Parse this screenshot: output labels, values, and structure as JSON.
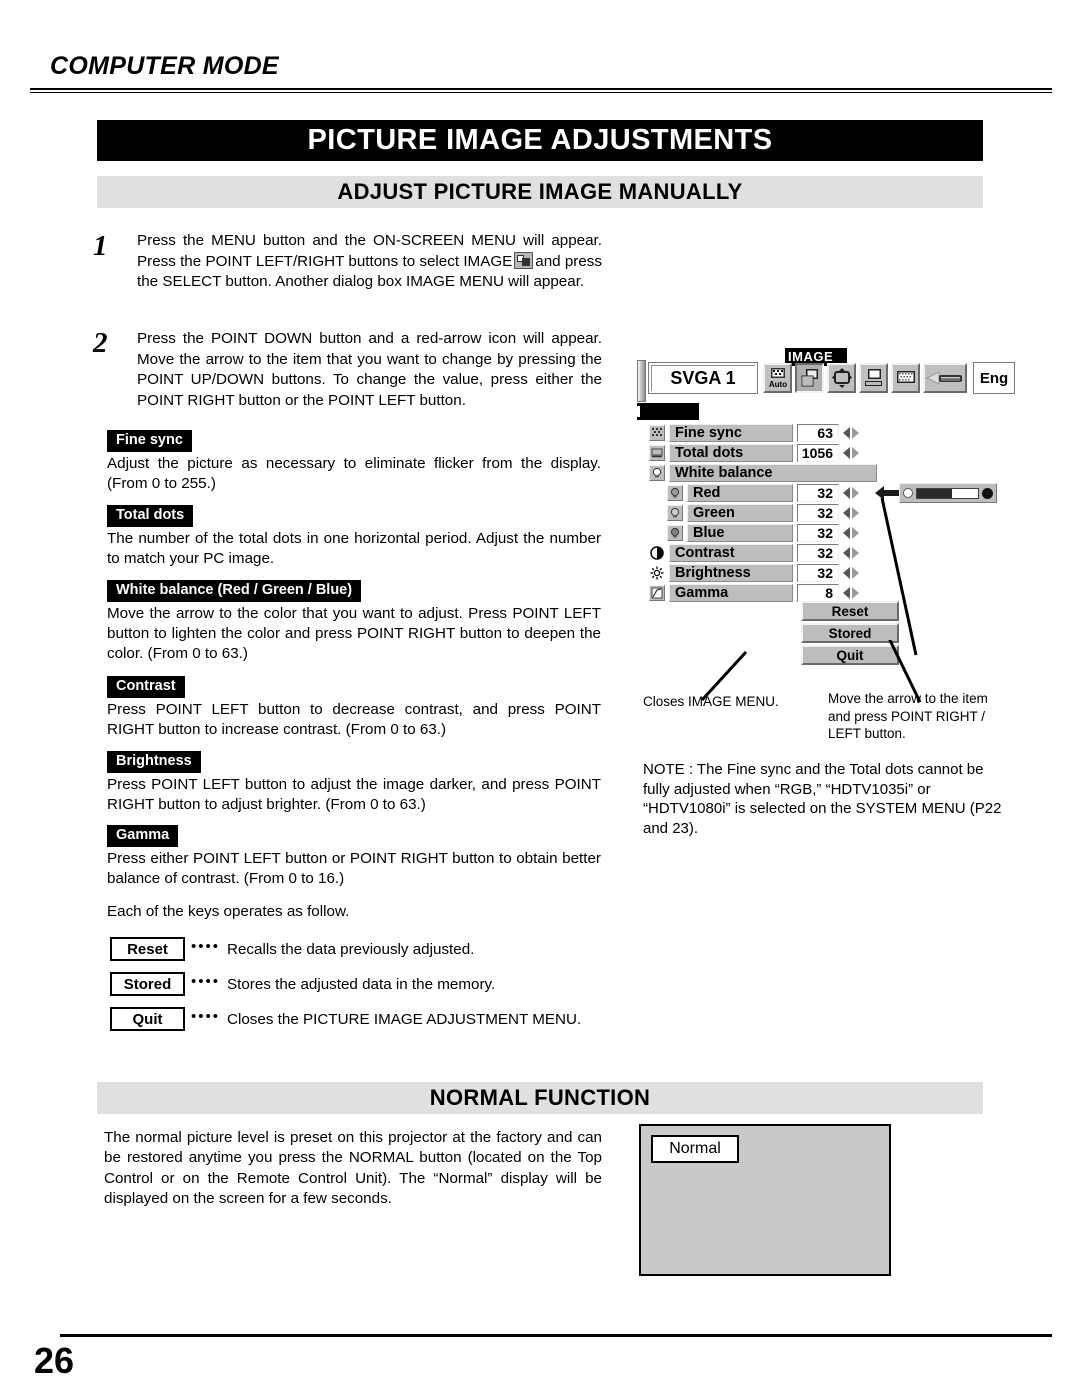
{
  "header": {
    "mode": "COMPUTER MODE"
  },
  "title_banner": "PICTURE IMAGE ADJUSTMENTS",
  "sections": {
    "manual_heading": "ADJUST PICTURE IMAGE MANUALLY",
    "normal_heading": "NORMAL FUNCTION"
  },
  "steps": [
    {
      "number": "1",
      "text_before_icon": "Press the MENU button and the ON-SCREEN MENU will appear.  Press the POINT LEFT/RIGHT buttons to select IMAGE",
      "icon": "image-menu-icon",
      "text_after_icon": "and press the SELECT button.  Another dialog box IMAGE MENU will appear."
    },
    {
      "number": "2",
      "text": "Press the POINT DOWN button and a red-arrow icon will appear.  Move the arrow to the item that you want to change by pressing the POINT UP/DOWN buttons.  To change the value, press either the POINT RIGHT button or the POINT LEFT button."
    }
  ],
  "items": [
    {
      "tag": "Fine sync",
      "body": "Adjust the picture as necessary to eliminate flicker from the display. (From 0 to 255.)"
    },
    {
      "tag": "Total dots",
      "body": "The number of the total dots in one horizontal period.  Adjust the number to match your PC image."
    },
    {
      "tag": "White balance (Red / Green / Blue)",
      "body": "Move the arrow to the color that you want to adjust.  Press POINT LEFT button to lighten the color and press POINT RIGHT button to deepen the color.  (From 0 to 63.)"
    },
    {
      "tag": "Contrast",
      "body": "Press POINT LEFT button to decrease contrast, and press POINT RIGHT button to increase contrast.  (From 0 to 63.)"
    },
    {
      "tag": "Brightness",
      "body": "Press POINT LEFT button to adjust the image darker, and press POINT RIGHT button to  adjust brighter.  (From 0 to 63.)"
    },
    {
      "tag": "Gamma",
      "body": "Press either POINT LEFT button or POINT RIGHT button to obtain better balance of contrast.  (From 0 to 16.)"
    }
  ],
  "keys": {
    "intro": "Each of the keys operates as follow.",
    "dots": "••••",
    "rows": [
      {
        "label": "Reset",
        "desc": "Recalls the data previously adjusted."
      },
      {
        "label": "Stored",
        "desc": "Stores the adjusted data in the memory."
      },
      {
        "label": "Quit",
        "desc": "Closes the PICTURE IMAGE ADJUSTMENT MENU."
      }
    ]
  },
  "osd": {
    "menu_label": "IMAGE",
    "source": "SVGA 1",
    "language": "Eng",
    "toolbar_icons": [
      "auto-image-icon",
      "image-adjust-icon",
      "screen-icon",
      "pc-system-icon",
      "display-icon",
      "projector-icon"
    ],
    "rows": [
      {
        "icon": "fine-sync-icon",
        "label": "Fine sync",
        "value": "63",
        "indent": false,
        "has_value": true
      },
      {
        "icon": "total-dots-icon",
        "label": "Total dots",
        "value": "1056",
        "indent": false,
        "has_value": true
      },
      {
        "icon": "white-balance-icon",
        "label": "White balance",
        "value": "",
        "indent": false,
        "has_value": false
      },
      {
        "icon": "red-icon",
        "label": "Red",
        "value": "32",
        "indent": true,
        "has_value": true
      },
      {
        "icon": "green-icon",
        "label": "Green",
        "value": "32",
        "indent": true,
        "has_value": true
      },
      {
        "icon": "blue-icon",
        "label": "Blue",
        "value": "32",
        "indent": true,
        "has_value": true
      },
      {
        "icon": "contrast-icon",
        "label": "Contrast",
        "value": "32",
        "indent": false,
        "has_value": true
      },
      {
        "icon": "brightness-icon",
        "label": "Brightness",
        "value": "32",
        "indent": false,
        "has_value": true
      },
      {
        "icon": "gamma-icon",
        "label": "Gamma",
        "value": "8",
        "indent": false,
        "has_value": true
      }
    ],
    "buttons": [
      "Reset",
      "Stored",
      "Quit"
    ]
  },
  "callouts": {
    "quit": "Closes IMAGE MENU.",
    "move": "Move the arrow to the item and press POINT RIGHT / LEFT button."
  },
  "note": {
    "lead": "NOTE :",
    "body": "The Fine sync and the Total dots cannot be fully adjusted when “RGB,” “HDTV1035i” or “HDTV1080i” is selected on the SYSTEM MENU (P22 and 23)."
  },
  "normal": {
    "text": "The normal picture level is preset on this projector at the factory and can be restored anytime you press the NORMAL button (located on the Top Control or on the Remote Control Unit).  The “Normal” display will be displayed on the screen for a few seconds.",
    "chip": "Normal"
  },
  "page_number": "26",
  "colors": {
    "banner_bg": "#000000",
    "subbanner_bg": "#e0e0e0",
    "osd_gray": "#bdbdbd",
    "screen_gray": "#c9c9c9"
  }
}
